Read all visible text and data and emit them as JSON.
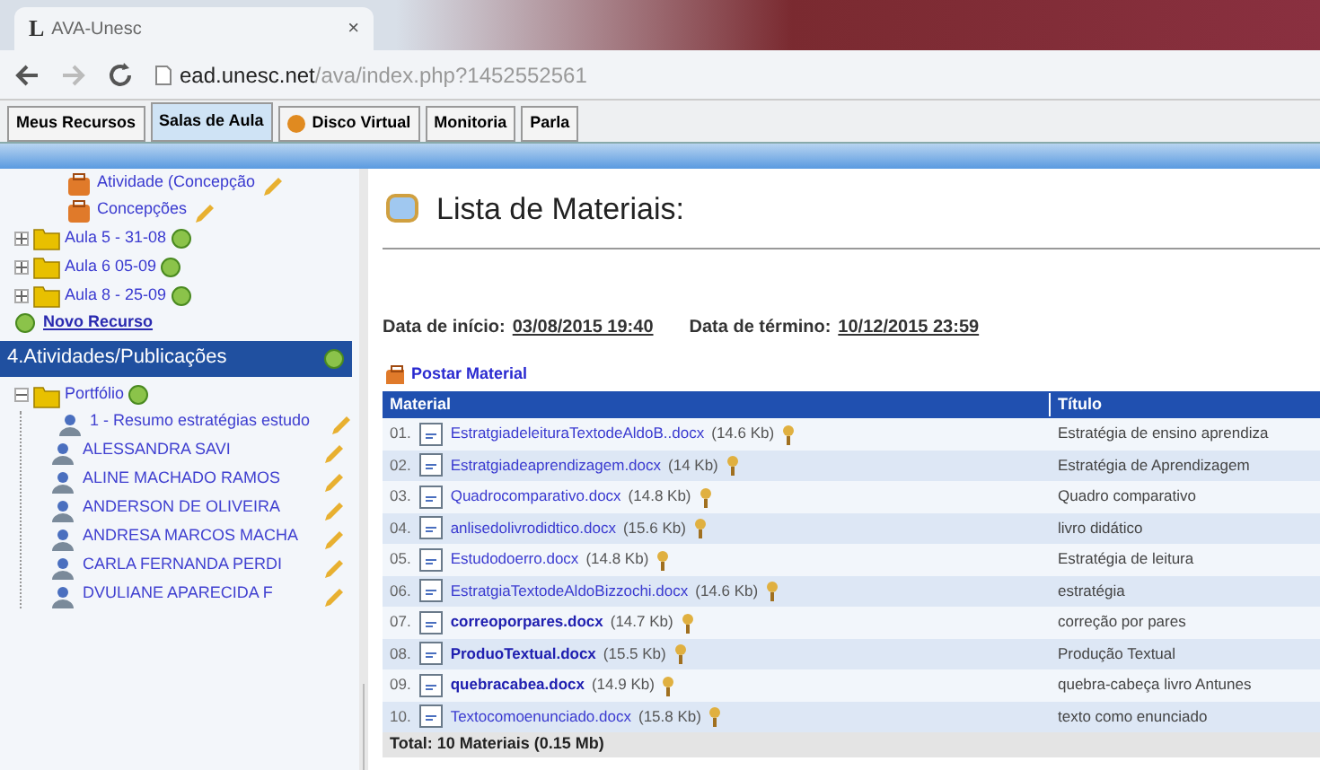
{
  "browser": {
    "logo": "L",
    "tab_title": "AVA-Unesc",
    "tab_close": "×",
    "url_host": "ead.unesc.net",
    "url_path": "/ava/index.php?1452552561"
  },
  "tabs": [
    {
      "label": "Meus Recursos",
      "selected": false,
      "icon": false
    },
    {
      "label": "Salas de Aula",
      "selected": true,
      "icon": false
    },
    {
      "label": "Disco Virtual",
      "selected": false,
      "icon": true
    },
    {
      "label": "Monitoria",
      "selected": false,
      "icon": false
    },
    {
      "label": "Parla",
      "selected": false,
      "icon": false
    }
  ],
  "sidebar": {
    "items": [
      {
        "kind": "resource",
        "label": "Atividade (Concepção"
      },
      {
        "kind": "resource",
        "label": "Concepções"
      },
      {
        "kind": "folder",
        "label": "Aula 5 - 31-08",
        "expanded": false
      },
      {
        "kind": "folder",
        "label": "Aula 6 05-09",
        "expanded": false
      },
      {
        "kind": "folder",
        "label": "Aula 8 - 25-09",
        "expanded": false
      },
      {
        "kind": "link",
        "label": "Novo Recurso"
      },
      {
        "kind": "section",
        "label": "4.Atividades/Publicações"
      },
      {
        "kind": "folder",
        "label": "Portfólio",
        "expanded": true,
        "children": [
          {
            "kind": "task",
            "label": "1 - Resumo estratégias estudo"
          },
          {
            "kind": "student",
            "label": "ALESSANDRA SAVI"
          },
          {
            "kind": "student",
            "label": "ALINE MACHADO RAMOS"
          },
          {
            "kind": "student",
            "label": "ANDERSON DE OLIVEIRA"
          },
          {
            "kind": "student",
            "label": "ANDRESA MARCOS MACHA"
          },
          {
            "kind": "student",
            "label": "CARLA FERNANDA PERDI"
          },
          {
            "kind": "student",
            "label": "DVULIANE APARECIDA F"
          }
        ]
      }
    ]
  },
  "main": {
    "title": "Lista de Materiais:",
    "start_label": "Data de início:",
    "start_value": "03/08/2015 19:40",
    "end_label": "Data de término:",
    "end_value": "10/12/2015 23:59",
    "post_link": "Postar Material",
    "table": {
      "columns": [
        "Material",
        "Título"
      ],
      "rows": [
        {
          "num": "01.",
          "file": "EstratgiadeleituraTextodeAldoB..docx",
          "size": "(14.6 Kb)",
          "title": "Estratégia de ensino aprendiza",
          "bold": false
        },
        {
          "num": "02.",
          "file": "Estratgiadeaprendizagem.docx",
          "size": "(14 Kb)",
          "title": "Estratégia de Aprendizagem",
          "bold": false
        },
        {
          "num": "03.",
          "file": "Quadrocomparativo.docx",
          "size": "(14.8 Kb)",
          "title": "Quadro comparativo",
          "bold": false
        },
        {
          "num": "04.",
          "file": "anlisedolivrodidtico.docx",
          "size": "(15.6 Kb)",
          "title": "livro didático",
          "bold": false
        },
        {
          "num": "05.",
          "file": "Estudodoerro.docx",
          "size": "(14.8 Kb)",
          "title": "Estratégia de leitura",
          "bold": false
        },
        {
          "num": "06.",
          "file": "EstratgiaTextodeAldoBizzochi.docx",
          "size": "(14.6 Kb)",
          "title": "estratégia",
          "bold": false
        },
        {
          "num": "07.",
          "file": "correoporpares.docx",
          "size": "(14.7 Kb)",
          "title": "correção por pares",
          "bold": true
        },
        {
          "num": "08.",
          "file": "ProduoTextual.docx",
          "size": "(15.5 Kb)",
          "title": "Produção Textual",
          "bold": true
        },
        {
          "num": "09.",
          "file": "quebracabea.docx",
          "size": "(14.9 Kb)",
          "title": "quebra-cabeça livro Antunes",
          "bold": true
        },
        {
          "num": "10.",
          "file": "Textocomoenunciado.docx",
          "size": "(15.8 Kb)",
          "title": "texto como enunciado",
          "bold": false
        }
      ],
      "total": "Total: 10 Materiais (0.15 Mb)"
    }
  }
}
